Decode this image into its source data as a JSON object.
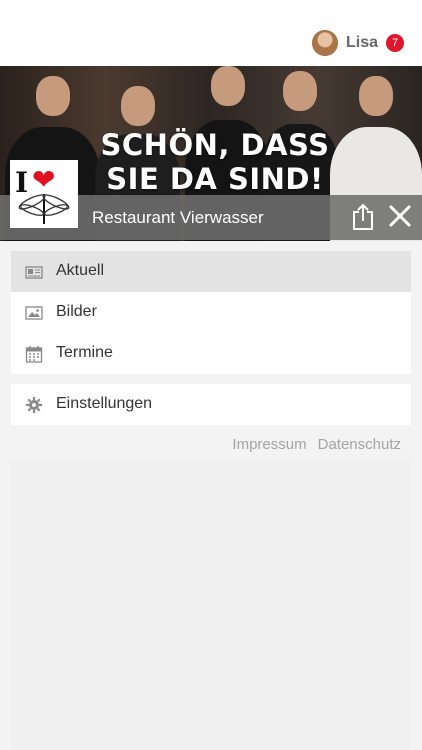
{
  "user": {
    "name": "Lisa",
    "notification_count": "7"
  },
  "hero": {
    "slogan_line1": "SCHÖN, DASS",
    "slogan_line2": "SIE DA SIND!"
  },
  "header": {
    "title": "Restaurant Vierwasser"
  },
  "logo": {
    "letter": "I"
  },
  "menu": {
    "main": [
      {
        "label": "Aktuell",
        "icon": "newspaper-icon",
        "active": true
      },
      {
        "label": "Bilder",
        "icon": "image-icon",
        "active": false
      },
      {
        "label": "Termine",
        "icon": "calendar-icon",
        "active": false
      }
    ],
    "settings": {
      "label": "Einstellungen",
      "icon": "gear-icon"
    }
  },
  "footer": {
    "impressum": "Impressum",
    "datenschutz": "Datenschutz"
  },
  "colors": {
    "badge": "#e1152b",
    "titlebar": "#6e6e6e",
    "active_item": "#e3e3e3"
  }
}
